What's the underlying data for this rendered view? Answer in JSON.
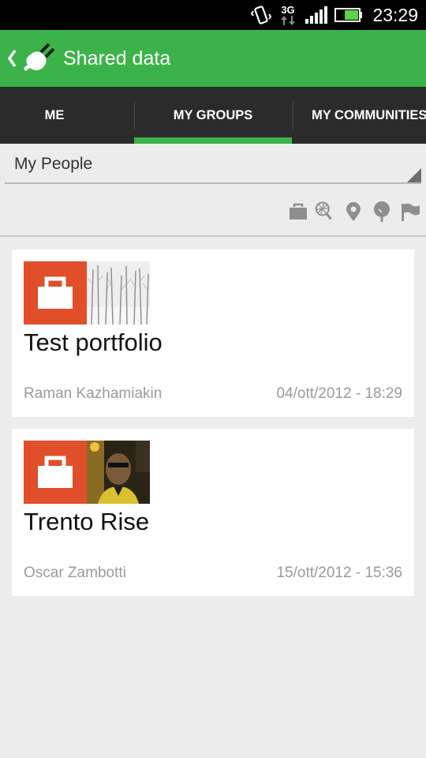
{
  "status_bar": {
    "network": "3G",
    "time": "23:29",
    "icons": [
      "vibrate-icon",
      "network-3g-icon",
      "signal-icon",
      "battery-icon"
    ]
  },
  "action_bar": {
    "title": "Shared data",
    "background": "#3cb34a"
  },
  "tabs": [
    {
      "label": "ME",
      "selected": false
    },
    {
      "label": "MY GROUPS",
      "selected": true
    },
    {
      "label": "MY COMMUNITIES",
      "selected": false
    }
  ],
  "spinner": {
    "selected": "My People"
  },
  "filter_icons": [
    "portfolio-icon",
    "sports-icon",
    "location-icon",
    "nature-icon",
    "flag-icon"
  ],
  "cards": [
    {
      "title": "Test portfolio",
      "author": "Raman Kazhamiakin",
      "date": "04/ott/2012 - 18:29",
      "type_icon": "portfolio-icon",
      "thumbnail": "snowy-trees-thumbnail"
    },
    {
      "title": "Trento Rise",
      "author": "Oscar Zambotti",
      "date": "15/ott/2012 - 15:36",
      "type_icon": "portfolio-icon",
      "thumbnail": "person-portrait-thumbnail"
    }
  ],
  "colors": {
    "accent": "#3cb34a",
    "tab_bar": "#2b2b2b",
    "tile": "#e04e2a"
  }
}
